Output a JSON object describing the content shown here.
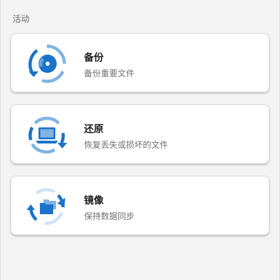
{
  "section": {
    "title": "活动"
  },
  "cards": [
    {
      "title": "备份",
      "description": "备份重要文件",
      "icon": "backup-icon"
    },
    {
      "title": "还原",
      "description": "恢复丢失或损坏的文件",
      "icon": "restore-icon"
    },
    {
      "title": "镜像",
      "description": "保持数据同步",
      "icon": "mirror-icon"
    }
  ],
  "colors": {
    "primary_blue": "#1a73c8",
    "light_blue": "#7fb3e3",
    "pale_blue": "#cfe3f6",
    "background": "#f3f3f3",
    "card": "#ffffff"
  }
}
